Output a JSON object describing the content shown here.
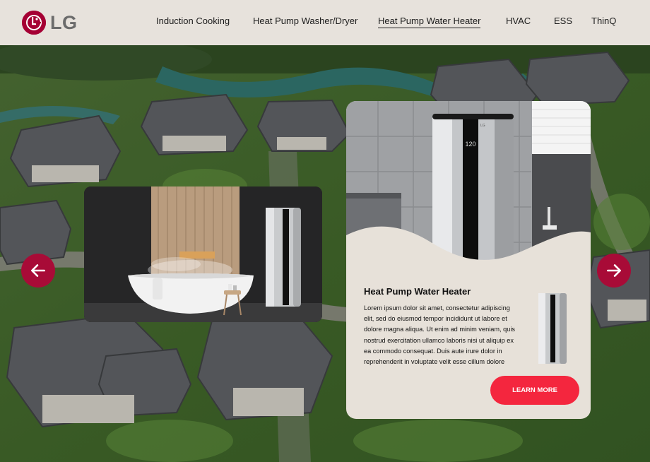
{
  "brand": {
    "name": "LG",
    "color": "#a50034"
  },
  "nav": {
    "items": [
      {
        "label": "Induction Cooking"
      },
      {
        "label": "Heat Pump Washer/Dryer"
      },
      {
        "label": "Heat Pump Water Heater",
        "active": true
      },
      {
        "label": "HVAC"
      },
      {
        "label": "ESS"
      },
      {
        "label": "ThinQ"
      }
    ]
  },
  "carousel": {
    "prev_icon": "arrow-left-icon",
    "next_icon": "arrow-right-icon",
    "accent": "#a80b37"
  },
  "product": {
    "title": "Heat Pump Water Heater",
    "display_reading": "120",
    "description": "Lorem ipsum dolor sit amet, consectetur adipiscing elit, sed do eiusmod tempor incididunt ut labore et dolore magna aliqua. Ut enim ad minim veniam, quis nostrud exercitation ullamco laboris nisi ut aliquip ex ea commodo consequat. Duis aute irure dolor in reprehenderit in voluptate velit esse cillum dolore",
    "cta_label": "LEARN MORE",
    "cta_color": "#f4263e"
  }
}
